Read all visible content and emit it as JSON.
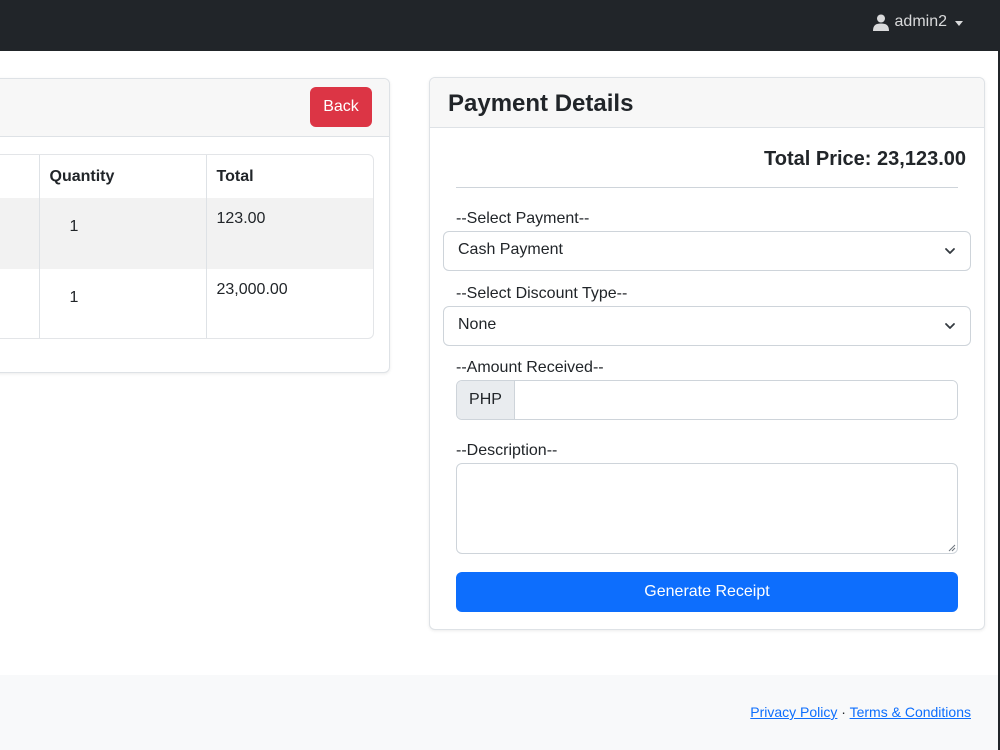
{
  "navbar": {
    "username": "admin2"
  },
  "order": {
    "back_label": "Back",
    "columns": [
      "",
      "Quantity",
      "Total"
    ],
    "rows": [
      {
        "quantity": "1",
        "total": "123.00"
      },
      {
        "quantity": "1",
        "total": "23,000.00"
      }
    ]
  },
  "payment": {
    "title": "Payment Details",
    "total_price": "Total Price: 23,123.00",
    "payment_label": "--Select Payment--",
    "payment_value": "Cash Payment",
    "discount_label": "--Select Discount Type--",
    "discount_value": "None",
    "amount_label": "--Amount Received--",
    "currency": "PHP",
    "amount_value": "",
    "description_label": "--Description--",
    "description_value": "",
    "generate_label": "Generate Receipt"
  },
  "footer": {
    "privacy": "Privacy Policy",
    "separator": "·",
    "terms": "Terms & Conditions"
  },
  "colors": {
    "navbar": "#212529",
    "danger": "#dc3545",
    "primary": "#0d6efd"
  }
}
